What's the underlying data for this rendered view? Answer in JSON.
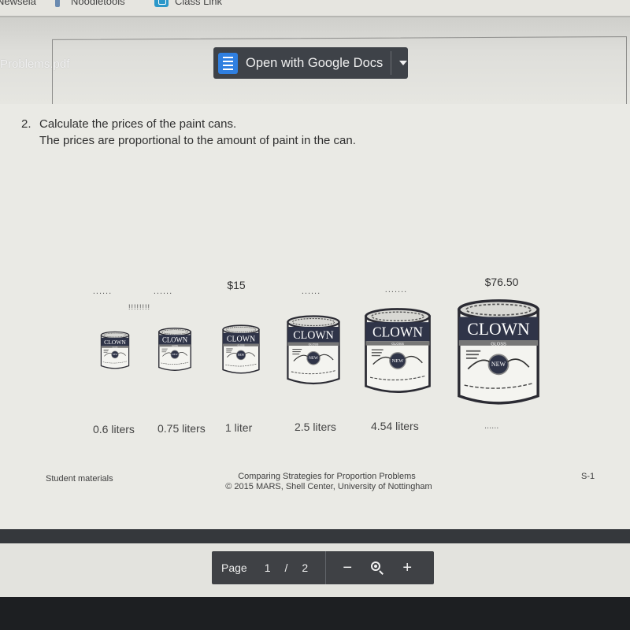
{
  "bookmarks": [
    {
      "label": "Newsela",
      "icon": "none"
    },
    {
      "label": "Noodletools",
      "icon": "pin-icon"
    },
    {
      "label": "Class Link",
      "icon": "classlink-icon"
    }
  ],
  "viewer": {
    "file_name": "Problems.pdf",
    "open_button_label": "Open with Google Docs",
    "open_button_icon": "google-docs-icon",
    "dropdown_icon": "caret-down-icon"
  },
  "document": {
    "question_number": "2.",
    "question_line1": "Calculate the prices of the paint cans.",
    "question_line2": "The prices are proportional to the amount of paint in the can.",
    "cans": [
      {
        "price": "......",
        "volume": "0.6 liters",
        "brand": "CLOWN",
        "note": "!!!!!!!!"
      },
      {
        "price": "......",
        "volume": "0.75 liters",
        "brand": "CLOWN"
      },
      {
        "price": "$15",
        "volume": "1 liter",
        "brand": "CLOWN"
      },
      {
        "price": "......",
        "volume": "2.5 liters",
        "brand": "CLOWN"
      },
      {
        "price": ".......",
        "volume": "4.54 liters",
        "brand": "CLOWN"
      },
      {
        "price": "$76.50",
        "volume": "......",
        "brand": "CLOWN"
      }
    ],
    "can_label_gloss": "GLOSS",
    "can_label_new": "NEW",
    "footer_left": "Student materials",
    "footer_center_line1": "Comparing Strategies for Proportion Problems",
    "footer_center_line2": "© 2015 MARS, Shell Center, University of Nottingham",
    "footer_right": "S-1"
  },
  "page_control": {
    "page_label": "Page",
    "current_page": "1",
    "separator": "/",
    "total_pages": "2",
    "zoom_out": "−",
    "zoom_in": "+"
  }
}
